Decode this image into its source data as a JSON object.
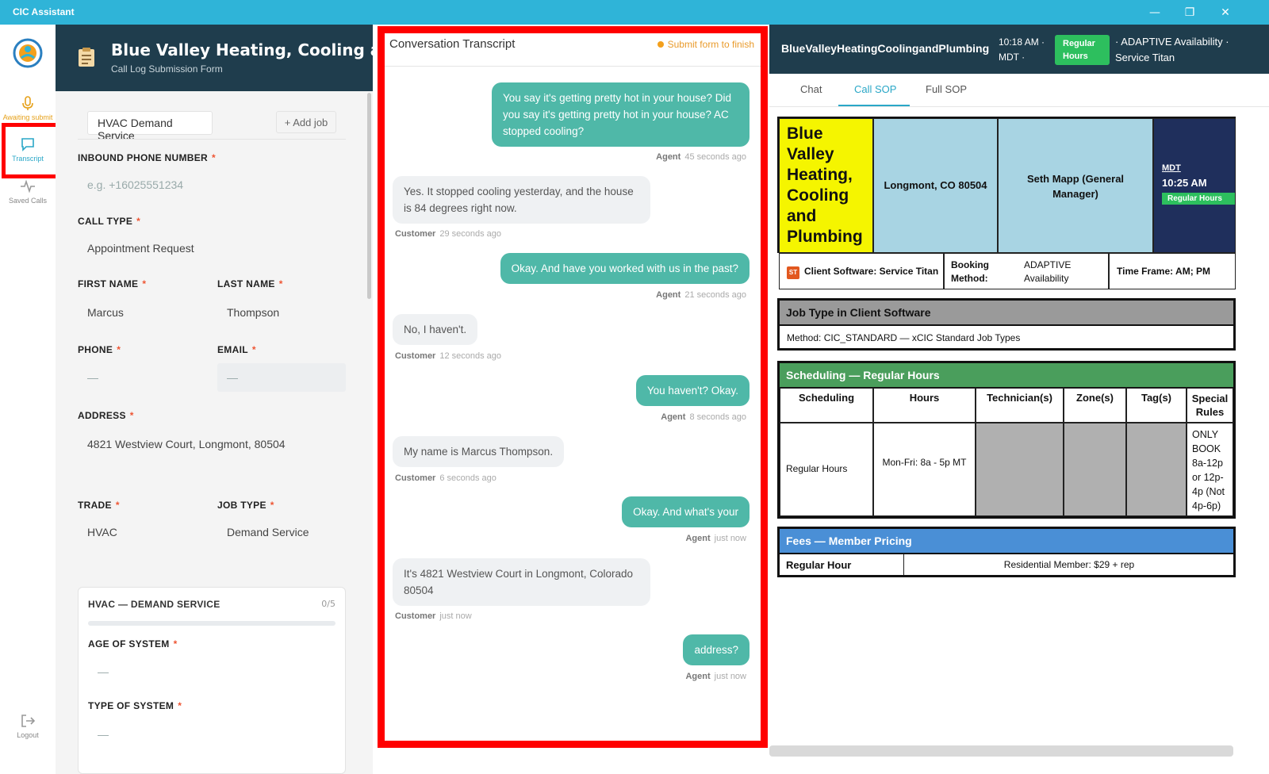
{
  "app": {
    "title": "CIC Assistant"
  },
  "rail": {
    "items": [
      {
        "label": "Awaiting submit"
      },
      {
        "label": "Transcript"
      },
      {
        "label": "Saved Calls"
      },
      {
        "label": "Logout"
      }
    ]
  },
  "form": {
    "company": "Blue Valley Heating, Cooling and Plumbing",
    "subtitle": "Call Log Submission Form",
    "job_tab": "HVAC Demand Service",
    "add_job": "+ Add job",
    "fields": {
      "inbound_phone": {
        "label": "INBOUND PHONE NUMBER",
        "placeholder": "e.g. +16025551234"
      },
      "call_type": {
        "label": "CALL TYPE",
        "value": "Appointment Request"
      },
      "first_name": {
        "label": "FIRST NAME",
        "value": "Marcus"
      },
      "last_name": {
        "label": "LAST NAME",
        "value": "Thompson"
      },
      "phone": {
        "label": "PHONE",
        "value": "—"
      },
      "email": {
        "label": "EMAIL",
        "value": "—"
      },
      "address": {
        "label": "ADDRESS",
        "value": "4821 Westview Court, Longmont, 80504"
      },
      "trade": {
        "label": "TRADE",
        "value": "HVAC"
      },
      "job_type": {
        "label": "JOB TYPE",
        "value": "Demand Service"
      }
    },
    "required_mark": "*",
    "service_card": {
      "title": "HVAC — DEMAND SERVICE",
      "count": "0/5",
      "progress": 0,
      "age": {
        "label": "AGE OF SYSTEM",
        "value": "—"
      },
      "type": {
        "label": "TYPE OF SYSTEM",
        "value": "—"
      }
    }
  },
  "transcript": {
    "title": "Conversation Transcript",
    "status": "Submit form to finish",
    "messages": [
      {
        "role": "Agent",
        "text": "You say it's getting pretty hot in your house? Did you say it's getting pretty hot in your house? AC stopped cooling?",
        "time": "45 seconds ago"
      },
      {
        "role": "Customer",
        "text": "Yes. It stopped cooling yesterday, and the house is 84 degrees right now.",
        "time": "29 seconds ago"
      },
      {
        "role": "Agent",
        "text": "Okay. And have you worked with us in the past?",
        "time": "21 seconds ago"
      },
      {
        "role": "Customer",
        "text": "No, I haven't.",
        "time": "12 seconds ago"
      },
      {
        "role": "Agent",
        "text": "You haven't? Okay.",
        "time": "8 seconds ago"
      },
      {
        "role": "Customer",
        "text": "My name is Marcus Thompson.",
        "time": "6 seconds ago"
      },
      {
        "role": "Agent",
        "text": "Okay. And what's your",
        "time": "just now"
      },
      {
        "role": "Customer",
        "text": "It's 4821 Westview Court in Longmont, Colorado 80504",
        "time": "just now"
      },
      {
        "role": "Agent",
        "text": "address?",
        "time": "just now"
      }
    ]
  },
  "sop": {
    "header": {
      "company": "BlueValleyHeatingCoolingandPlumbing",
      "time": "10:18 AM ·",
      "tz": "MDT ·",
      "badge": "Regular Hours",
      "availability": "· ADAPTIVE Availability ·",
      "software": "Service Titan"
    },
    "tabs": [
      "Chat",
      "Call SOP",
      "Full SOP"
    ],
    "active_tab": "Call SOP",
    "info": {
      "company": "Blue Valley Heating, Cooling and Plumbing",
      "location": "Longmont, CO 80504",
      "manager": "Seth Mapp (General Manager)",
      "tz": "MDT",
      "time": "10:25 AM",
      "hours_badge": "Regular Hours",
      "software_icon": "ST",
      "software": "Client Software: Service Titan",
      "booking_label": "Booking Method:",
      "booking_value": "ADAPTIVE Availability",
      "timeframe": "Time Frame: AM; PM"
    },
    "job_type": {
      "title": "Job Type in Client Software",
      "method": "Method: CIC_STANDARD — xCIC Standard Job Types"
    },
    "scheduling": {
      "title": "Scheduling — Regular Hours",
      "columns": [
        "Scheduling",
        "Hours",
        "Technician(s)",
        "Zone(s)",
        "Tag(s)",
        "Special Rules"
      ],
      "row": {
        "scheduling": "Regular Hours",
        "hours": "Mon-Fri: 8a - 5p MT",
        "special": "ONLY BOOK 8a-12p or 12p-4p (Not 4p-6p)"
      }
    },
    "fees": {
      "title": "Fees — Member Pricing",
      "label": "Regular Hour",
      "value": "Residential Member: $29 + rep"
    }
  },
  "colors": {
    "titlebar": "#2fb4d8",
    "header_dark": "#1f3d4d",
    "agent_bubble": "#4fb8a8",
    "highlight": "#ff0000",
    "regular_badge": "#2dbf5e",
    "scheduling_header": "#4a9e5c",
    "fees_header": "#4a8fd6",
    "company_yellow": "#f5f500",
    "info_blue": "#a8d4e3"
  }
}
